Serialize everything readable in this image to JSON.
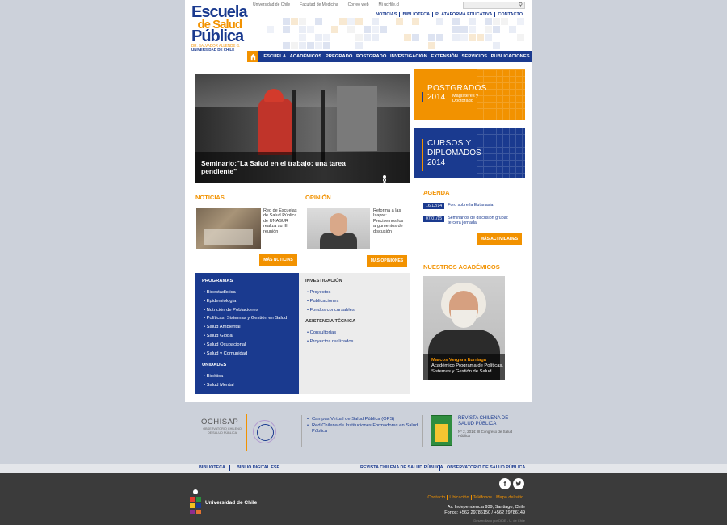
{
  "utility_bar": {
    "links": [
      "Universidad de Chile",
      "Facultad de Medicina",
      "Correo web",
      "Mi ucHile.cl"
    ],
    "search_placeholder": ""
  },
  "quick_links": [
    "NOTICIAS",
    "BIBLIOTECA",
    "PLATAFORMA EDUCATIVA",
    "CONTACTO"
  ],
  "logo": {
    "line1": "Escuela",
    "line2": "de Salud",
    "line3": "Pública",
    "line4": "DR. SALVADOR ALLENDE G.",
    "line5": "UNIVERSIDAD DE CHILE"
  },
  "nav": {
    "items": [
      "ESCUELA",
      "ACADÉMICOS",
      "PREGRADO",
      "POSTGRADO",
      "INVESTIGACIÓN",
      "EXTENSIÓN",
      "SERVICIOS",
      "PUBLICACIONES"
    ]
  },
  "hero": {
    "caption": "Seminario:\"La Salud en el trabajo: una tarea pendiente\""
  },
  "promos": {
    "postgrados_title": "POSTGRADOS",
    "postgrados_year": "2014",
    "postgrados_sub": "Magísteres y Doctorado",
    "cursos_title1": "CURSOS Y",
    "cursos_title2": "DIPLOMADOS",
    "cursos_year": "2014"
  },
  "noticias": {
    "title": "NOTICIAS",
    "text": "Red de Escuelas de Salud Pública de UNASUR realiza su III reunión",
    "button": "MÁS NOTICIAS"
  },
  "opinion": {
    "title": "OPINIÓN",
    "text": "Reforma a las Isapre: Precisemos los argumentos de discusión",
    "button": "MÁS OPINIONES"
  },
  "agenda": {
    "title": "AGENDA",
    "items": [
      {
        "date": "16/12/14",
        "label": "Foro sobre la Eutanasia"
      },
      {
        "date": "07/01/15",
        "label": "Seminarios de discusión grupal: tercera jornada"
      }
    ],
    "button": "MÁS ACTIVIDADES"
  },
  "programas": {
    "title": "PROGRAMAS",
    "items": [
      "Bioestadística",
      "Epidemiología",
      "Nutrición de Poblaciones",
      "Políticas, Sistemas y Gestión en Salud",
      "Salud Ambiental",
      "Salud Global",
      "Salud Ocupacional",
      "Salud y Comunidad"
    ],
    "unidades_title": "UNIDADES",
    "unidades": [
      "Bioética",
      "Salud Mental"
    ]
  },
  "investigacion": {
    "title": "INVESTIGACIÓN",
    "items": [
      "Proyectos",
      "Publicaciones",
      "Fondos concursables"
    ],
    "asistencia_title": "ASISTENCIA TÉCNICA",
    "asistencia": [
      "Consultorías",
      "Proyectos realizados"
    ]
  },
  "academicos": {
    "title": "NUESTROS ACADÉMICOS",
    "name": "Marcos Vergara Iturriaga",
    "role": "Académico Programa de Políticas, Sistemas y Gestión de Salud"
  },
  "ochisap": {
    "name": "OCHISAP",
    "sub": "OBSERVATORIO CHILENO DE SALUD PÚBLICA"
  },
  "external_links": [
    "Campus Virtual de Salud Pública (OPS)",
    "Red Chilena de Instituciones Formadoras en Salud Pública"
  ],
  "revista": {
    "title": "REVISTA CHILENA DE SALUD PÚBLICA",
    "desc": "Nº 2, 2014: III Congreso de Salud Pública"
  },
  "footer_strip": [
    "BIBLIOTECA",
    "BIBLIO DIGITAL ESP",
    "REVISTA CHILENA DE SALUD PÚBLICA",
    "OBSERVATORIO DE SALUD PÚBLICA"
  ],
  "footer": {
    "uchile": "Universidad de Chile",
    "links": [
      "Contacto",
      "Ubicación",
      "Teléfonos",
      "Mapa del sitio"
    ],
    "address": "Av. Independencia 939, Santiago, Chile",
    "phones": "Fonos: +562 29786150 / +562 29786149",
    "dev": "Desarrollado por DIDE - U. de Chile"
  },
  "colors": {
    "brand_blue": "#1a3a8f",
    "brand_orange": "#f29200",
    "background": "#ccd1da",
    "footer": "#3b3b3b"
  }
}
